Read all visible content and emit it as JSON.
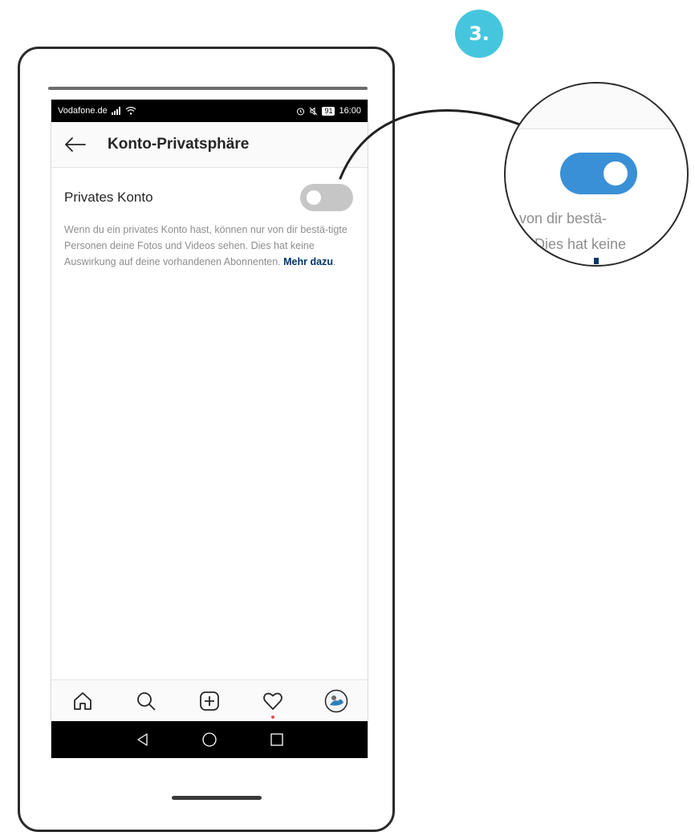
{
  "step": {
    "label": "3."
  },
  "status_bar": {
    "carrier": "Vodafone.de",
    "battery": "91",
    "time": "16:00"
  },
  "header": {
    "title": "Konto-Privatsphäre",
    "back_icon": "arrow-left-icon"
  },
  "setting": {
    "label": "Privates Konto",
    "toggle_state": "off",
    "description": "Wenn du ein privates Konto hast, können nur von dir bestä-tigte Personen deine Fotos und Videos sehen. Dies hat keine Auswirkung auf deine vorhandenen Abonnenten.",
    "more_link": "Mehr dazu",
    "trailing": "."
  },
  "bottom_nav": {
    "items": [
      "home-icon",
      "search-icon",
      "add-post-icon",
      "activity-heart-icon",
      "profile-avatar-icon"
    ]
  },
  "android_nav": {
    "items": [
      "back-triangle-icon",
      "home-circle-icon",
      "recents-square-icon"
    ]
  },
  "zoom": {
    "toggle_state": "on",
    "line1": "r von dir bestä-",
    "line2": "Dies hat keine",
    "colors": {
      "toggle_on": "#3a90d6",
      "badge": "#45c6de"
    }
  }
}
